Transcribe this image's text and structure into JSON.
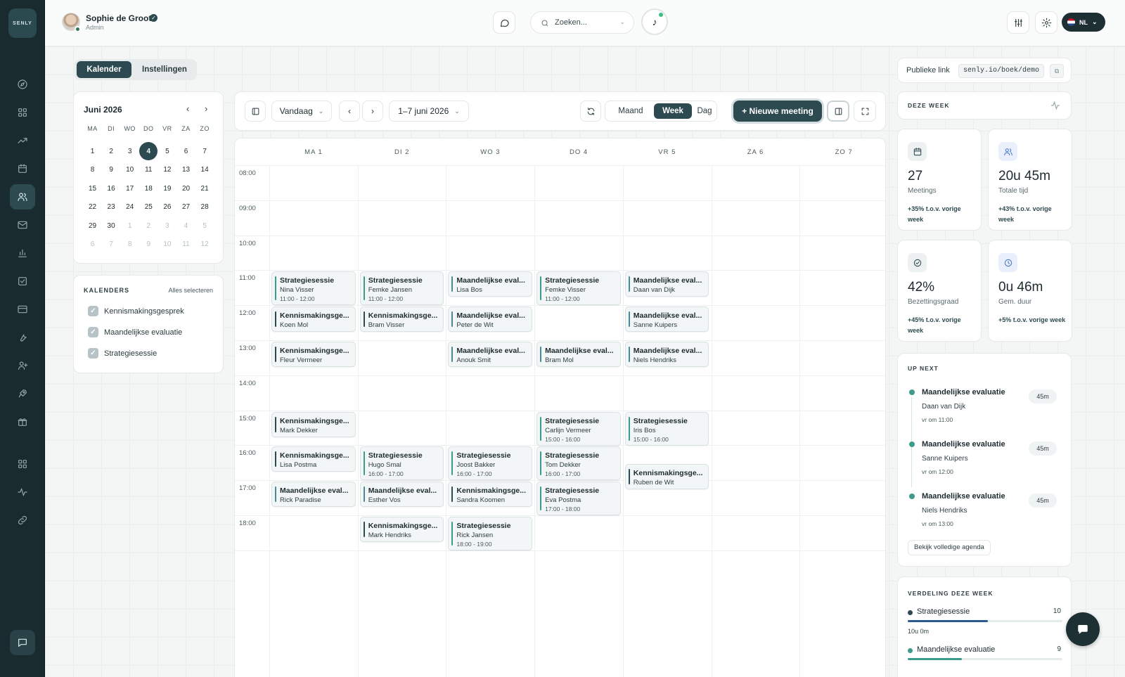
{
  "user": {
    "name": "Sophie de Groot",
    "role": "Admin"
  },
  "logo": "SENLY",
  "search": {
    "placeholder": "Zoeken..."
  },
  "language": "NL",
  "colors": {
    "accent": "#2d4a50",
    "sidebar": "#1a2b2f",
    "strategie": "#3c9c8c",
    "maandelijkse": "#4a8a94",
    "kennismaking": "#2d4a50"
  },
  "tabs": [
    "Kalender",
    "Instellingen"
  ],
  "public_link": {
    "label": "Publieke link",
    "url": "senly.io/boek/demo"
  },
  "mini_calendar": {
    "title": "Juni 2026",
    "weekdays": [
      "MA",
      "DI",
      "WO",
      "DO",
      "VR",
      "ZA",
      "ZO"
    ],
    "weeks": [
      [
        "1",
        "2",
        "3",
        "4",
        "5",
        "6",
        "7"
      ],
      [
        "8",
        "9",
        "10",
        "11",
        "12",
        "13",
        "14"
      ],
      [
        "15",
        "16",
        "17",
        "18",
        "19",
        "20",
        "21"
      ],
      [
        "22",
        "23",
        "24",
        "25",
        "26",
        "27",
        "28"
      ],
      [
        "29",
        "30",
        "1",
        "2",
        "3",
        "4",
        "5"
      ],
      [
        "6",
        "7",
        "8",
        "9",
        "10",
        "11",
        "12"
      ]
    ],
    "today": "4"
  },
  "calendars": {
    "title": "KALENDERS",
    "select_all": "Alles selecteren",
    "items": [
      "Kennismakingsgesprek",
      "Maandelijkse evaluatie",
      "Strategiesessie"
    ]
  },
  "toolbar": {
    "today": "Vandaag",
    "range": "1–7 juni 2026",
    "views": [
      "Maand",
      "Week",
      "Dag"
    ],
    "active_view": "Week",
    "new_meeting": "+ Nieuwe meeting"
  },
  "week": {
    "days": [
      "MA 1",
      "DI 2",
      "WO 3",
      "DO 4",
      "VR 5",
      "ZA 6",
      "ZO 7"
    ],
    "hours": [
      "08:00",
      "09:00",
      "10:00",
      "11:00",
      "12:00",
      "13:00",
      "14:00",
      "15:00",
      "16:00",
      "17:00",
      "18:00"
    ],
    "events": [
      {
        "day": 0,
        "hour": "11:00",
        "title": "Strategiesessie",
        "person": "Nina Visser",
        "time": "11:00 - 12:00",
        "type": "strategie"
      },
      {
        "day": 1,
        "hour": "11:00",
        "title": "Strategiesessie",
        "person": "Femke Jansen",
        "time": "11:00 - 12:00",
        "type": "strategie"
      },
      {
        "day": 2,
        "hour": "11:00",
        "title": "Maandelijkse eval...",
        "person": "Lisa Bos",
        "time": "",
        "type": "maandelijkse"
      },
      {
        "day": 3,
        "hour": "11:00",
        "title": "Strategiesessie",
        "person": "Femke Visser",
        "time": "11:00 - 12:00",
        "type": "strategie"
      },
      {
        "day": 4,
        "hour": "11:00",
        "title": "Maandelijkse eval...",
        "person": "Daan van Dijk",
        "time": "",
        "type": "maandelijkse"
      },
      {
        "day": 0,
        "hour": "12:00",
        "title": "Kennismakingsge...",
        "person": "Koen Mol",
        "time": "",
        "type": "kennismaking"
      },
      {
        "day": 1,
        "hour": "12:00",
        "title": "Kennismakingsge...",
        "person": "Bram Visser",
        "time": "",
        "type": "kennismaking"
      },
      {
        "day": 2,
        "hour": "12:00",
        "title": "Maandelijkse eval...",
        "person": "Peter de Wit",
        "time": "",
        "type": "maandelijkse"
      },
      {
        "day": 4,
        "hour": "12:00",
        "title": "Maandelijkse eval...",
        "person": "Sanne Kuipers",
        "time": "",
        "type": "maandelijkse"
      },
      {
        "day": 0,
        "hour": "13:00",
        "title": "Kennismakingsge...",
        "person": "Fleur Vermeer",
        "time": "",
        "type": "kennismaking"
      },
      {
        "day": 2,
        "hour": "13:00",
        "title": "Maandelijkse eval...",
        "person": "Anouk Smit",
        "time": "",
        "type": "maandelijkse"
      },
      {
        "day": 3,
        "hour": "13:00",
        "title": "Maandelijkse eval...",
        "person": "Bram Mol",
        "time": "",
        "type": "maandelijkse"
      },
      {
        "day": 4,
        "hour": "13:00",
        "title": "Maandelijkse eval...",
        "person": "Niels Hendriks",
        "time": "",
        "type": "maandelijkse"
      },
      {
        "day": 0,
        "hour": "15:00",
        "title": "Kennismakingsge...",
        "person": "Mark Dekker",
        "time": "",
        "type": "kennismaking"
      },
      {
        "day": 3,
        "hour": "15:00",
        "title": "Strategiesessie",
        "person": "Carlijn Vermeer",
        "time": "15:00 - 16:00",
        "type": "strategie"
      },
      {
        "day": 4,
        "hour": "15:00",
        "title": "Strategiesessie",
        "person": "Iris Bos",
        "time": "15:00 - 16:00",
        "type": "strategie"
      },
      {
        "day": 0,
        "hour": "16:00",
        "title": "Kennismakingsge...",
        "person": "Lisa Postma",
        "time": "",
        "type": "kennismaking"
      },
      {
        "day": 1,
        "hour": "16:00",
        "title": "Strategiesessie",
        "person": "Hugo Smal",
        "time": "16:00 - 17:00",
        "type": "strategie"
      },
      {
        "day": 2,
        "hour": "16:00",
        "title": "Strategiesessie",
        "person": "Joost Bakker",
        "time": "16:00 - 17:00",
        "type": "strategie"
      },
      {
        "day": 3,
        "hour": "16:00",
        "title": "Strategiesessie",
        "person": "Tom Dekker",
        "time": "16:00 - 17:00",
        "type": "strategie"
      },
      {
        "day": 4,
        "hour": "16:30",
        "title": "Kennismakingsge...",
        "person": "Ruben de Wit",
        "time": "",
        "type": "kennismaking"
      },
      {
        "day": 0,
        "hour": "17:00",
        "title": "Maandelijkse eval...",
        "person": "Rick Paradise",
        "time": "",
        "type": "maandelijkse"
      },
      {
        "day": 1,
        "hour": "17:00",
        "title": "Maandelijkse eval...",
        "person": "Esther Vos",
        "time": "",
        "type": "maandelijkse"
      },
      {
        "day": 2,
        "hour": "17:00",
        "title": "Kennismakingsge...",
        "person": "Sandra Koomen",
        "time": "",
        "type": "kennismaking"
      },
      {
        "day": 3,
        "hour": "17:00",
        "title": "Strategiesessie",
        "person": "Eva Postma",
        "time": "17:00 - 18:00",
        "type": "strategie"
      },
      {
        "day": 1,
        "hour": "18:00",
        "title": "Kennismakingsge...",
        "person": "Mark Hendriks",
        "time": "",
        "type": "kennismaking"
      },
      {
        "day": 2,
        "hour": "18:00",
        "title": "Strategiesessie",
        "person": "Rick Jansen",
        "time": "18:00 - 19:00",
        "type": "strategie"
      }
    ]
  },
  "this_week": {
    "title": "DEZE WEEK"
  },
  "stats": [
    {
      "value": "27",
      "label": "Meetings",
      "delta": "+35% t.o.v. vorige week",
      "icon": "calendar-icon"
    },
    {
      "value": "20u 45m",
      "label": "Totale tijd",
      "delta": "+43% t.o.v. vorige week",
      "icon": "users-icon"
    },
    {
      "value": "42%",
      "label": "Bezettingsgraad",
      "delta": "+45% t.o.v. vorige week",
      "icon": "check-circle-icon"
    },
    {
      "value": "0u 46m",
      "label": "Gem. duur",
      "delta": "+5% t.o.v. vorige week",
      "icon": "clock-icon"
    }
  ],
  "up_next": {
    "title": "UP NEXT",
    "items": [
      {
        "title": "Maandelijkse evaluatie",
        "person": "Daan van Dijk",
        "when": "vr om 11:00",
        "duration": "45m"
      },
      {
        "title": "Maandelijkse evaluatie",
        "person": "Sanne Kuipers",
        "when": "vr om 12:00",
        "duration": "45m"
      },
      {
        "title": "Maandelijkse evaluatie",
        "person": "Niels Hendriks",
        "when": "vr om 13:00",
        "duration": "45m"
      }
    ],
    "link": "Bekijk volledige agenda"
  },
  "distribution": {
    "title": "VERDELING DEZE WEEK",
    "items": [
      {
        "name": "Strategiesessie",
        "count": "10",
        "time": "10u 0m",
        "fill": 0.52
      },
      {
        "name": "Maandelijkse evaluatie",
        "count": "9",
        "time": "",
        "fill": 0.35
      }
    ]
  }
}
